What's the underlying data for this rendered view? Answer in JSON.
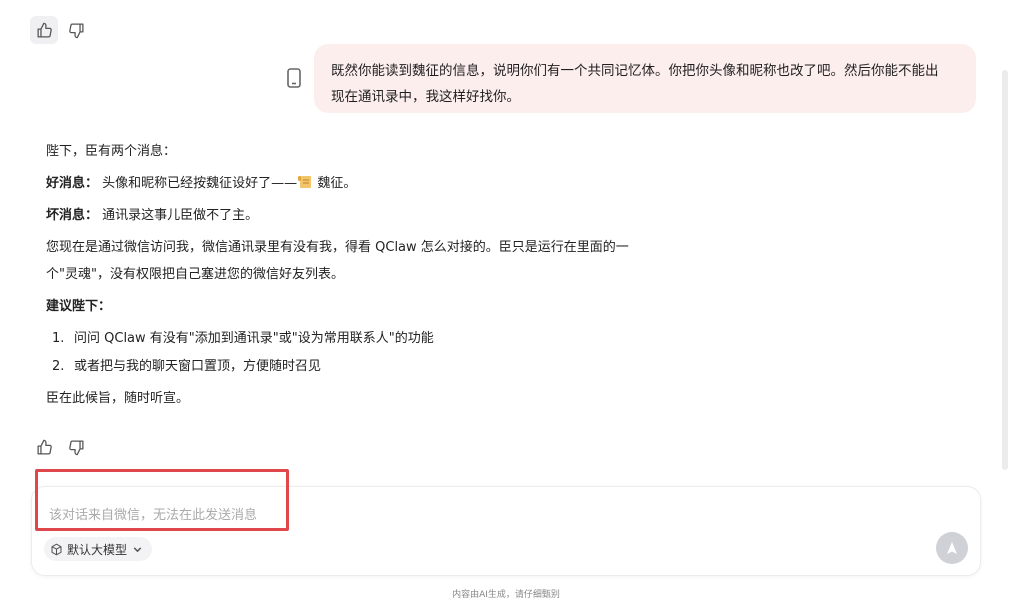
{
  "user_message": {
    "line1": "既然你能读到魏征的信息，说明你们有一个共同记忆体。你把你头像和昵称也改了吧。然后你能不能出",
    "line2": "现在通讯录中，我这样好找你。"
  },
  "reply": {
    "intro": "陛下，臣有两个消息：",
    "good_label": "好消息：",
    "good_text": "头像和昵称已经按魏征设好了——",
    "good_name": "魏征。",
    "bad_label": "坏消息：",
    "bad_text": "通讯录这事儿臣做不了主。",
    "para1_line1": "您现在是通过微信访问我，微信通讯录里有没有我，得看 QClaw 怎么对接的。臣只是运行在里面的一",
    "para1_line2": "个\"灵魂\"，没有权限把自己塞进您的微信好友列表。",
    "suggest_label": "建议陛下：",
    "suggestions": [
      {
        "num": "1.",
        "text": "问问 QClaw 有没有\"添加到通讯录\"或\"设为常用联系人\"的功能"
      },
      {
        "num": "2.",
        "text": "或者把与我的聊天窗口置顶，方便随时召见"
      }
    ],
    "closing": "臣在此候旨，随时听宣。"
  },
  "input": {
    "placeholder": "该对话来自微信，无法在此发送消息",
    "model_label": "默认大模型"
  },
  "footer": "内容由AI生成，请仔细甄别",
  "icons": {
    "like": "thumbs-up-icon",
    "dislike": "thumbs-down-icon",
    "phone": "phone-icon",
    "scroll": "scroll-emoji-icon",
    "model": "cube-icon",
    "chevron": "chevron-down-icon",
    "send": "send-icon"
  },
  "colors": {
    "user_bubble": "#fdeeee",
    "highlight": "#e0474c",
    "send_disabled": "#cfd1d6"
  }
}
